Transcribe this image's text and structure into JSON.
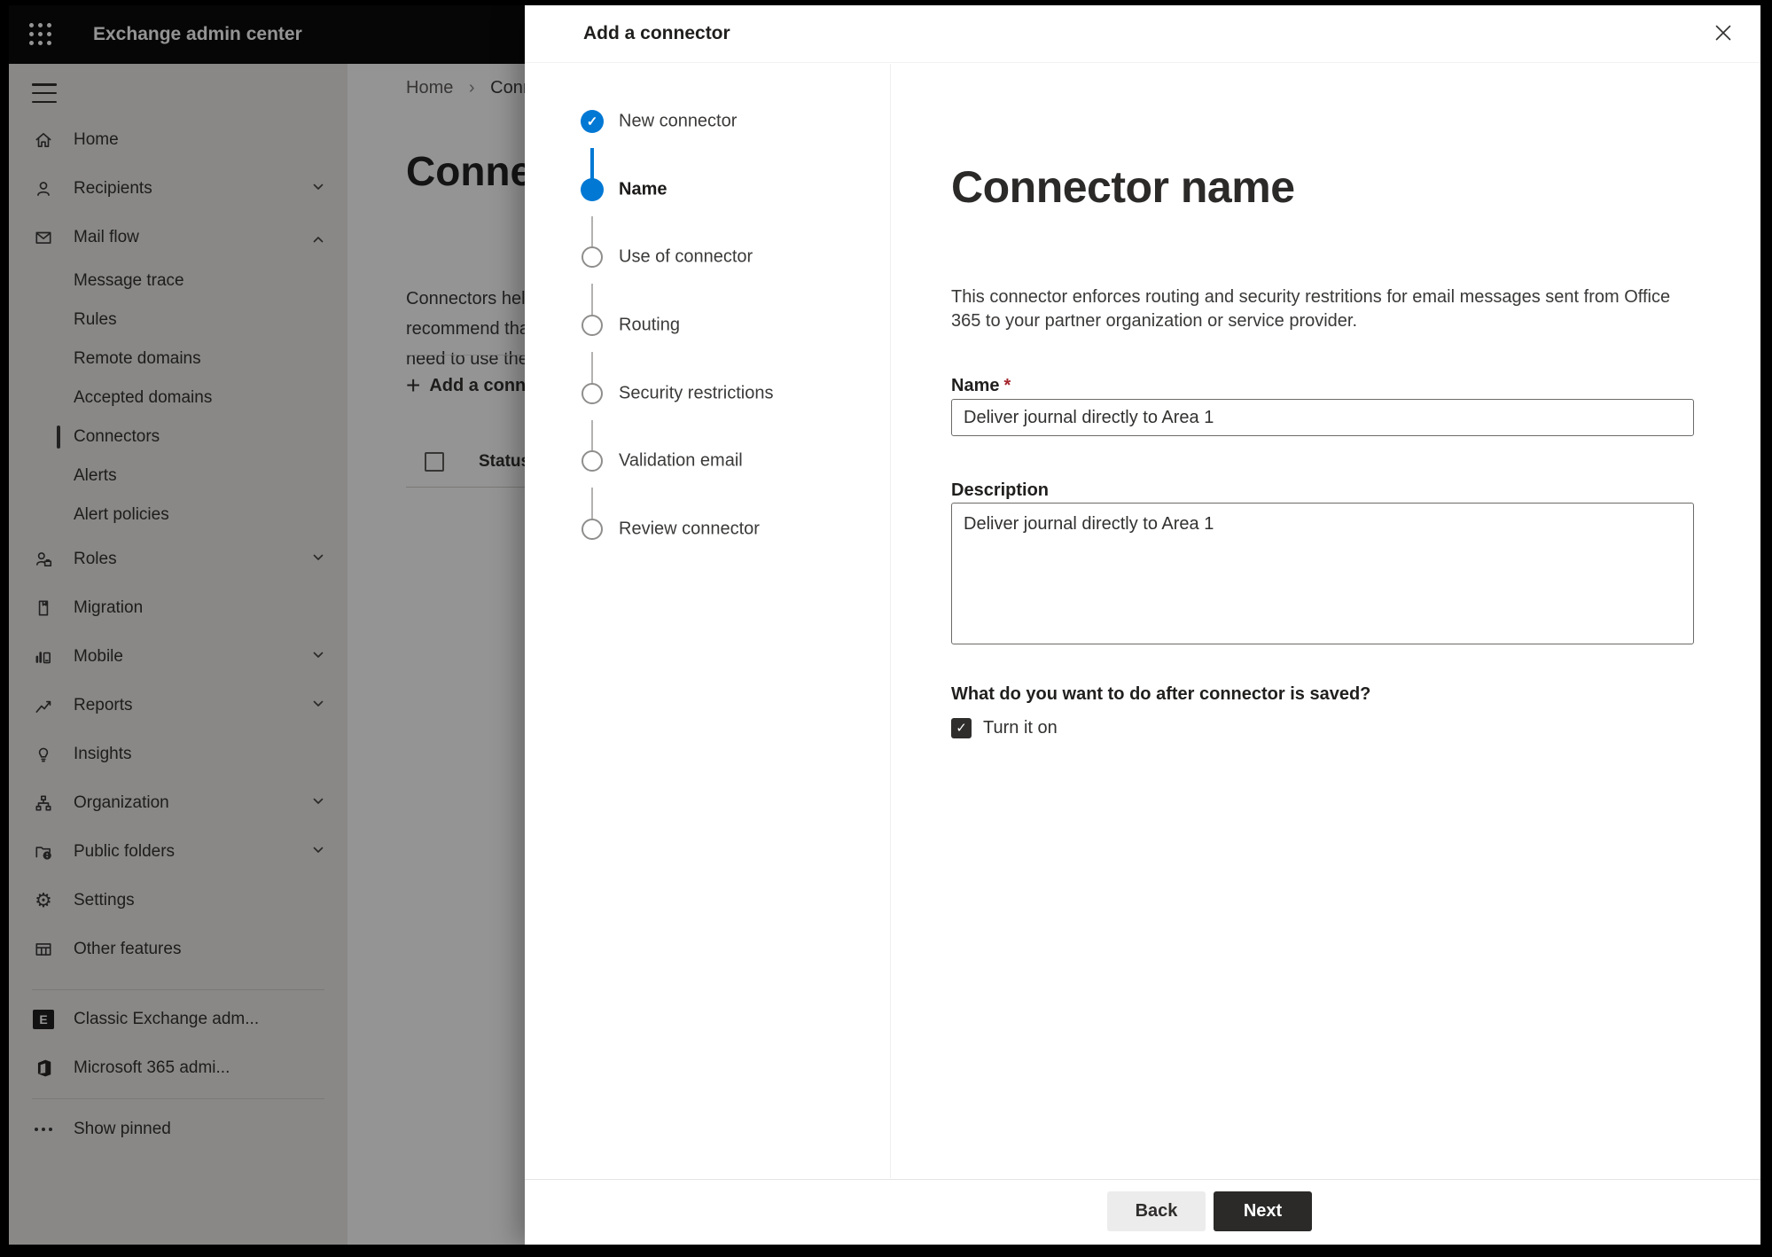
{
  "topbar": {
    "title": "Exchange admin center"
  },
  "icons": {
    "check": "✓",
    "gear": "⚙",
    "plus": "+",
    "exchange_letter": "E",
    "breadcrumb_separator": "›"
  },
  "sidebar": {
    "items": [
      {
        "label": "Home",
        "type": "top",
        "chevron": "none"
      },
      {
        "label": "Recipients",
        "type": "top",
        "chevron": "down"
      },
      {
        "label": "Mail flow",
        "type": "top",
        "chevron": "up",
        "expanded": true
      },
      {
        "label": "Message trace",
        "type": "sub"
      },
      {
        "label": "Rules",
        "type": "sub"
      },
      {
        "label": "Remote domains",
        "type": "sub"
      },
      {
        "label": "Accepted domains",
        "type": "sub"
      },
      {
        "label": "Connectors",
        "type": "sub",
        "selected": true
      },
      {
        "label": "Alerts",
        "type": "sub"
      },
      {
        "label": "Alert policies",
        "type": "sub"
      },
      {
        "label": "Roles",
        "type": "top",
        "chevron": "down"
      },
      {
        "label": "Migration",
        "type": "top",
        "chevron": "none"
      },
      {
        "label": "Mobile",
        "type": "top",
        "chevron": "down"
      },
      {
        "label": "Reports",
        "type": "top",
        "chevron": "down"
      },
      {
        "label": "Insights",
        "type": "top",
        "chevron": "none"
      },
      {
        "label": "Organization",
        "type": "top",
        "chevron": "down"
      },
      {
        "label": "Public folders",
        "type": "top",
        "chevron": "down"
      },
      {
        "label": "Settings",
        "type": "top",
        "chevron": "none"
      },
      {
        "label": "Other features",
        "type": "top",
        "chevron": "none"
      },
      {
        "label": "Classic Exchange adm...",
        "type": "bottom"
      },
      {
        "label": "Microsoft 365 admi...",
        "type": "bottom"
      },
      {
        "label": "Show pinned",
        "type": "bottom"
      }
    ]
  },
  "page": {
    "breadcrumb": {
      "home": "Home",
      "current": "Conne"
    },
    "title": "Connec",
    "intro_lines": [
      "Connectors help",
      "recommend that",
      "need to use ther"
    ],
    "add_button_label": "Add a conn",
    "status_header": "Status"
  },
  "dialog": {
    "title": "Add a connector",
    "steps": [
      {
        "label": "New connector",
        "state": "completed"
      },
      {
        "label": "Name",
        "state": "active"
      },
      {
        "label": "Use of connector",
        "state": "pending"
      },
      {
        "label": "Routing",
        "state": "pending"
      },
      {
        "label": "Security restrictions",
        "state": "pending"
      },
      {
        "label": "Validation email",
        "state": "pending"
      },
      {
        "label": "Review connector",
        "state": "pending"
      }
    ],
    "content": {
      "heading": "Connector name",
      "description": "This connector enforces routing and security restritions for email messages sent from Office 365 to your partner organization or service provider.",
      "name_label": "Name",
      "required_marker": "*",
      "name_value": "Deliver journal directly to Area 1",
      "description_label": "Description",
      "description_value": "Deliver journal directly to Area 1",
      "after_save_question": "What do you want to do after connector is saved?",
      "turn_on_label": "Turn it on",
      "turn_on_checked": true
    },
    "footer": {
      "back_label": "Back",
      "next_label": "Next"
    }
  },
  "colors": {
    "accent_blue": "#0078d4",
    "topbar_bg": "#0b0b0b",
    "sidebar_bg": "#edebe9",
    "required_red": "#a4262c",
    "next_button_bg": "#2b2a29",
    "back_button_bg": "#ececec",
    "text_primary": "#323130",
    "overlay": "rgba(0,0,0,0.42)"
  }
}
